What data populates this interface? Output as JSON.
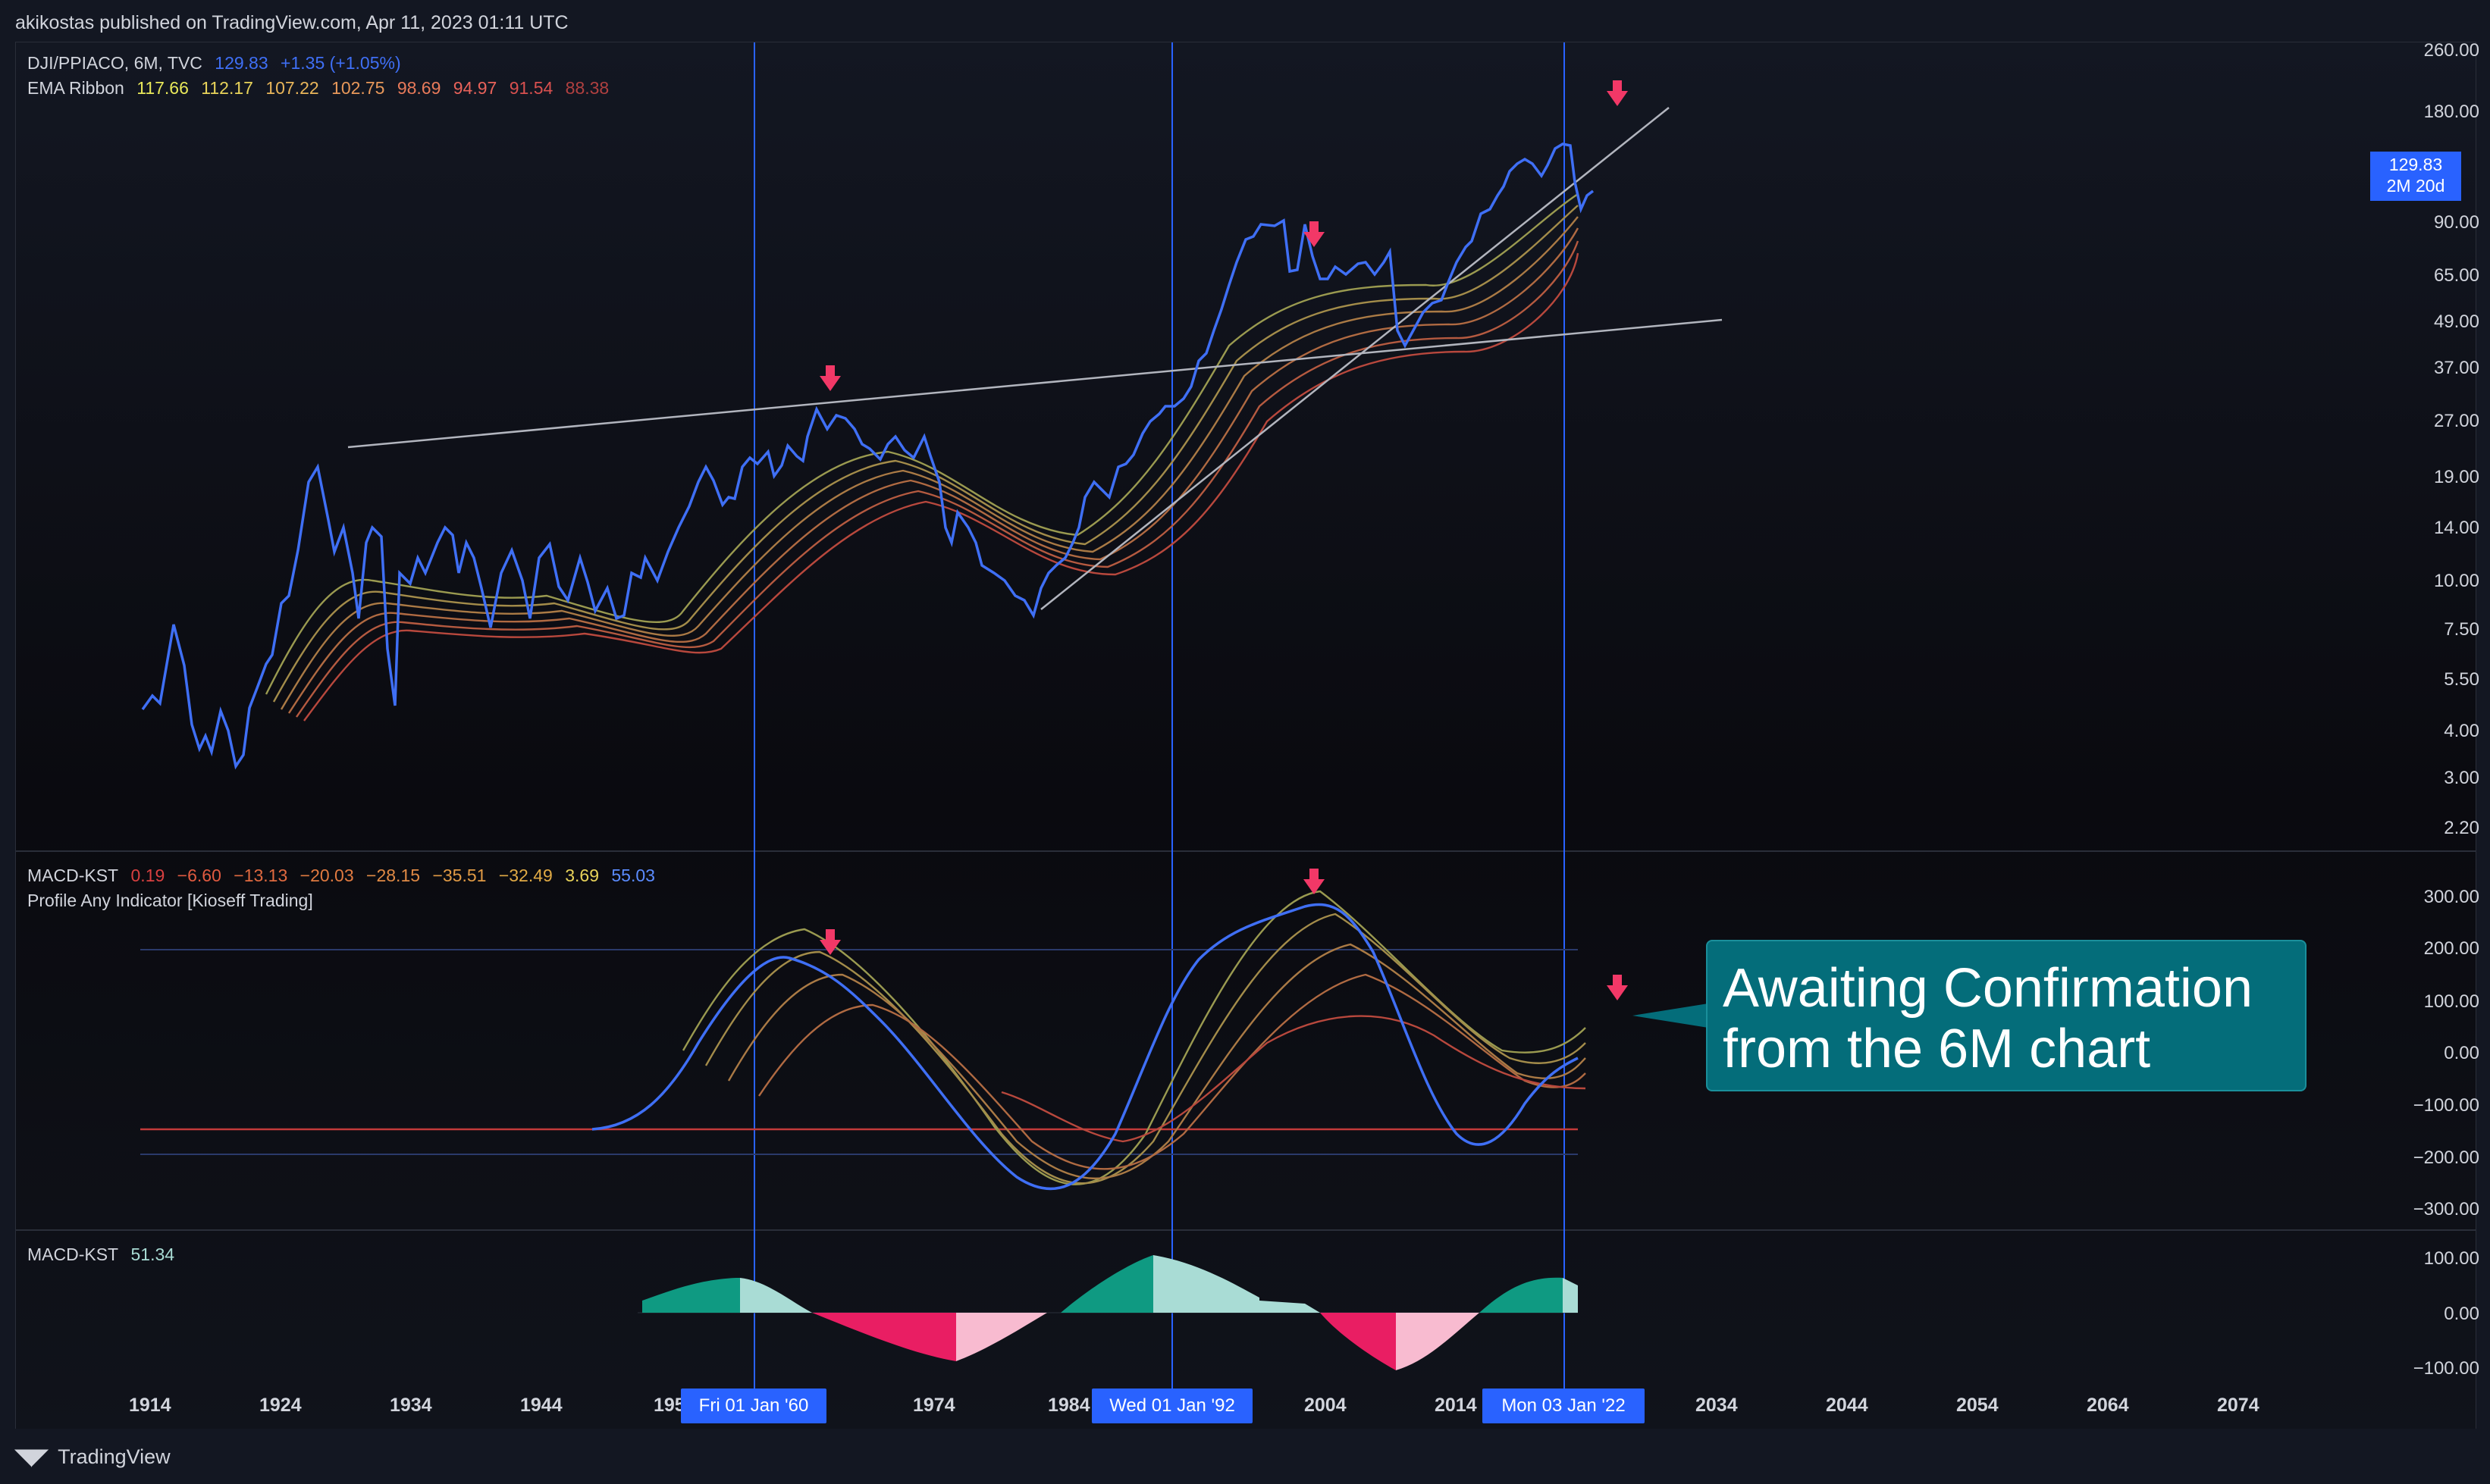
{
  "header": {
    "published": "akikostas published on TradingView.com, Apr 11, 2023 01:11 UTC"
  },
  "main_legend": {
    "symbol": "DJI/PPIACO, 6M, TVC",
    "price": "129.83",
    "change": "+1.35 (+1.05%)",
    "ema_label": "EMA Ribbon",
    "ema_values": [
      "117.66",
      "112.17",
      "107.22",
      "102.75",
      "98.69",
      "94.97",
      "91.54",
      "88.38"
    ]
  },
  "macd_legend": {
    "label": "MACD-KST",
    "values": [
      "0.19",
      "−6.60",
      "−13.13",
      "−20.03",
      "−28.15",
      "−35.51",
      "−32.49",
      "3.69",
      "55.03"
    ],
    "profile": "Profile Any Indicator [Kioseff Trading]"
  },
  "hist_legend": {
    "label": "MACD-KST",
    "value": "51.34"
  },
  "price_tag": {
    "price": "129.83",
    "countdown": "2M 20d"
  },
  "price_axis": [
    "260.00",
    "180.00",
    "90.00",
    "65.00",
    "49.00",
    "37.00",
    "27.00",
    "19.00",
    "14.00",
    "10.00",
    "7.50",
    "5.50",
    "4.00",
    "3.00",
    "2.20"
  ],
  "macd_axis": [
    "300.00",
    "200.00",
    "100.00",
    "0.00",
    "−100.00",
    "−200.00",
    "−300.00"
  ],
  "hist_axis": [
    "100.00",
    "0.00",
    "−100.00"
  ],
  "time_axis": [
    "1914",
    "1924",
    "1934",
    "1944",
    "195",
    "1974",
    "1984",
    "2004",
    "2014",
    "2034",
    "2044",
    "2054",
    "2064",
    "2074"
  ],
  "time_badges": [
    "Fri 01 Jan '60",
    "Wed 01 Jan '92",
    "Mon 03 Jan '22"
  ],
  "callout": {
    "line1": "Awaiting Confirmation",
    "line2": "from the 6M chart"
  },
  "footer": {
    "brand": "TradingView"
  },
  "colors": {
    "price_line": "#3f6ff5",
    "accent": "#2962ff",
    "arrow": "#f23867",
    "hist_green": "#0f9a82",
    "hist_light_green": "#a9dcd5",
    "hist_red": "#e91e63",
    "hist_pink": "#f8bbd0",
    "callout": "#046d7a"
  },
  "icons": [
    "down-arrow-icon",
    "tradingview-logo-icon"
  ]
}
